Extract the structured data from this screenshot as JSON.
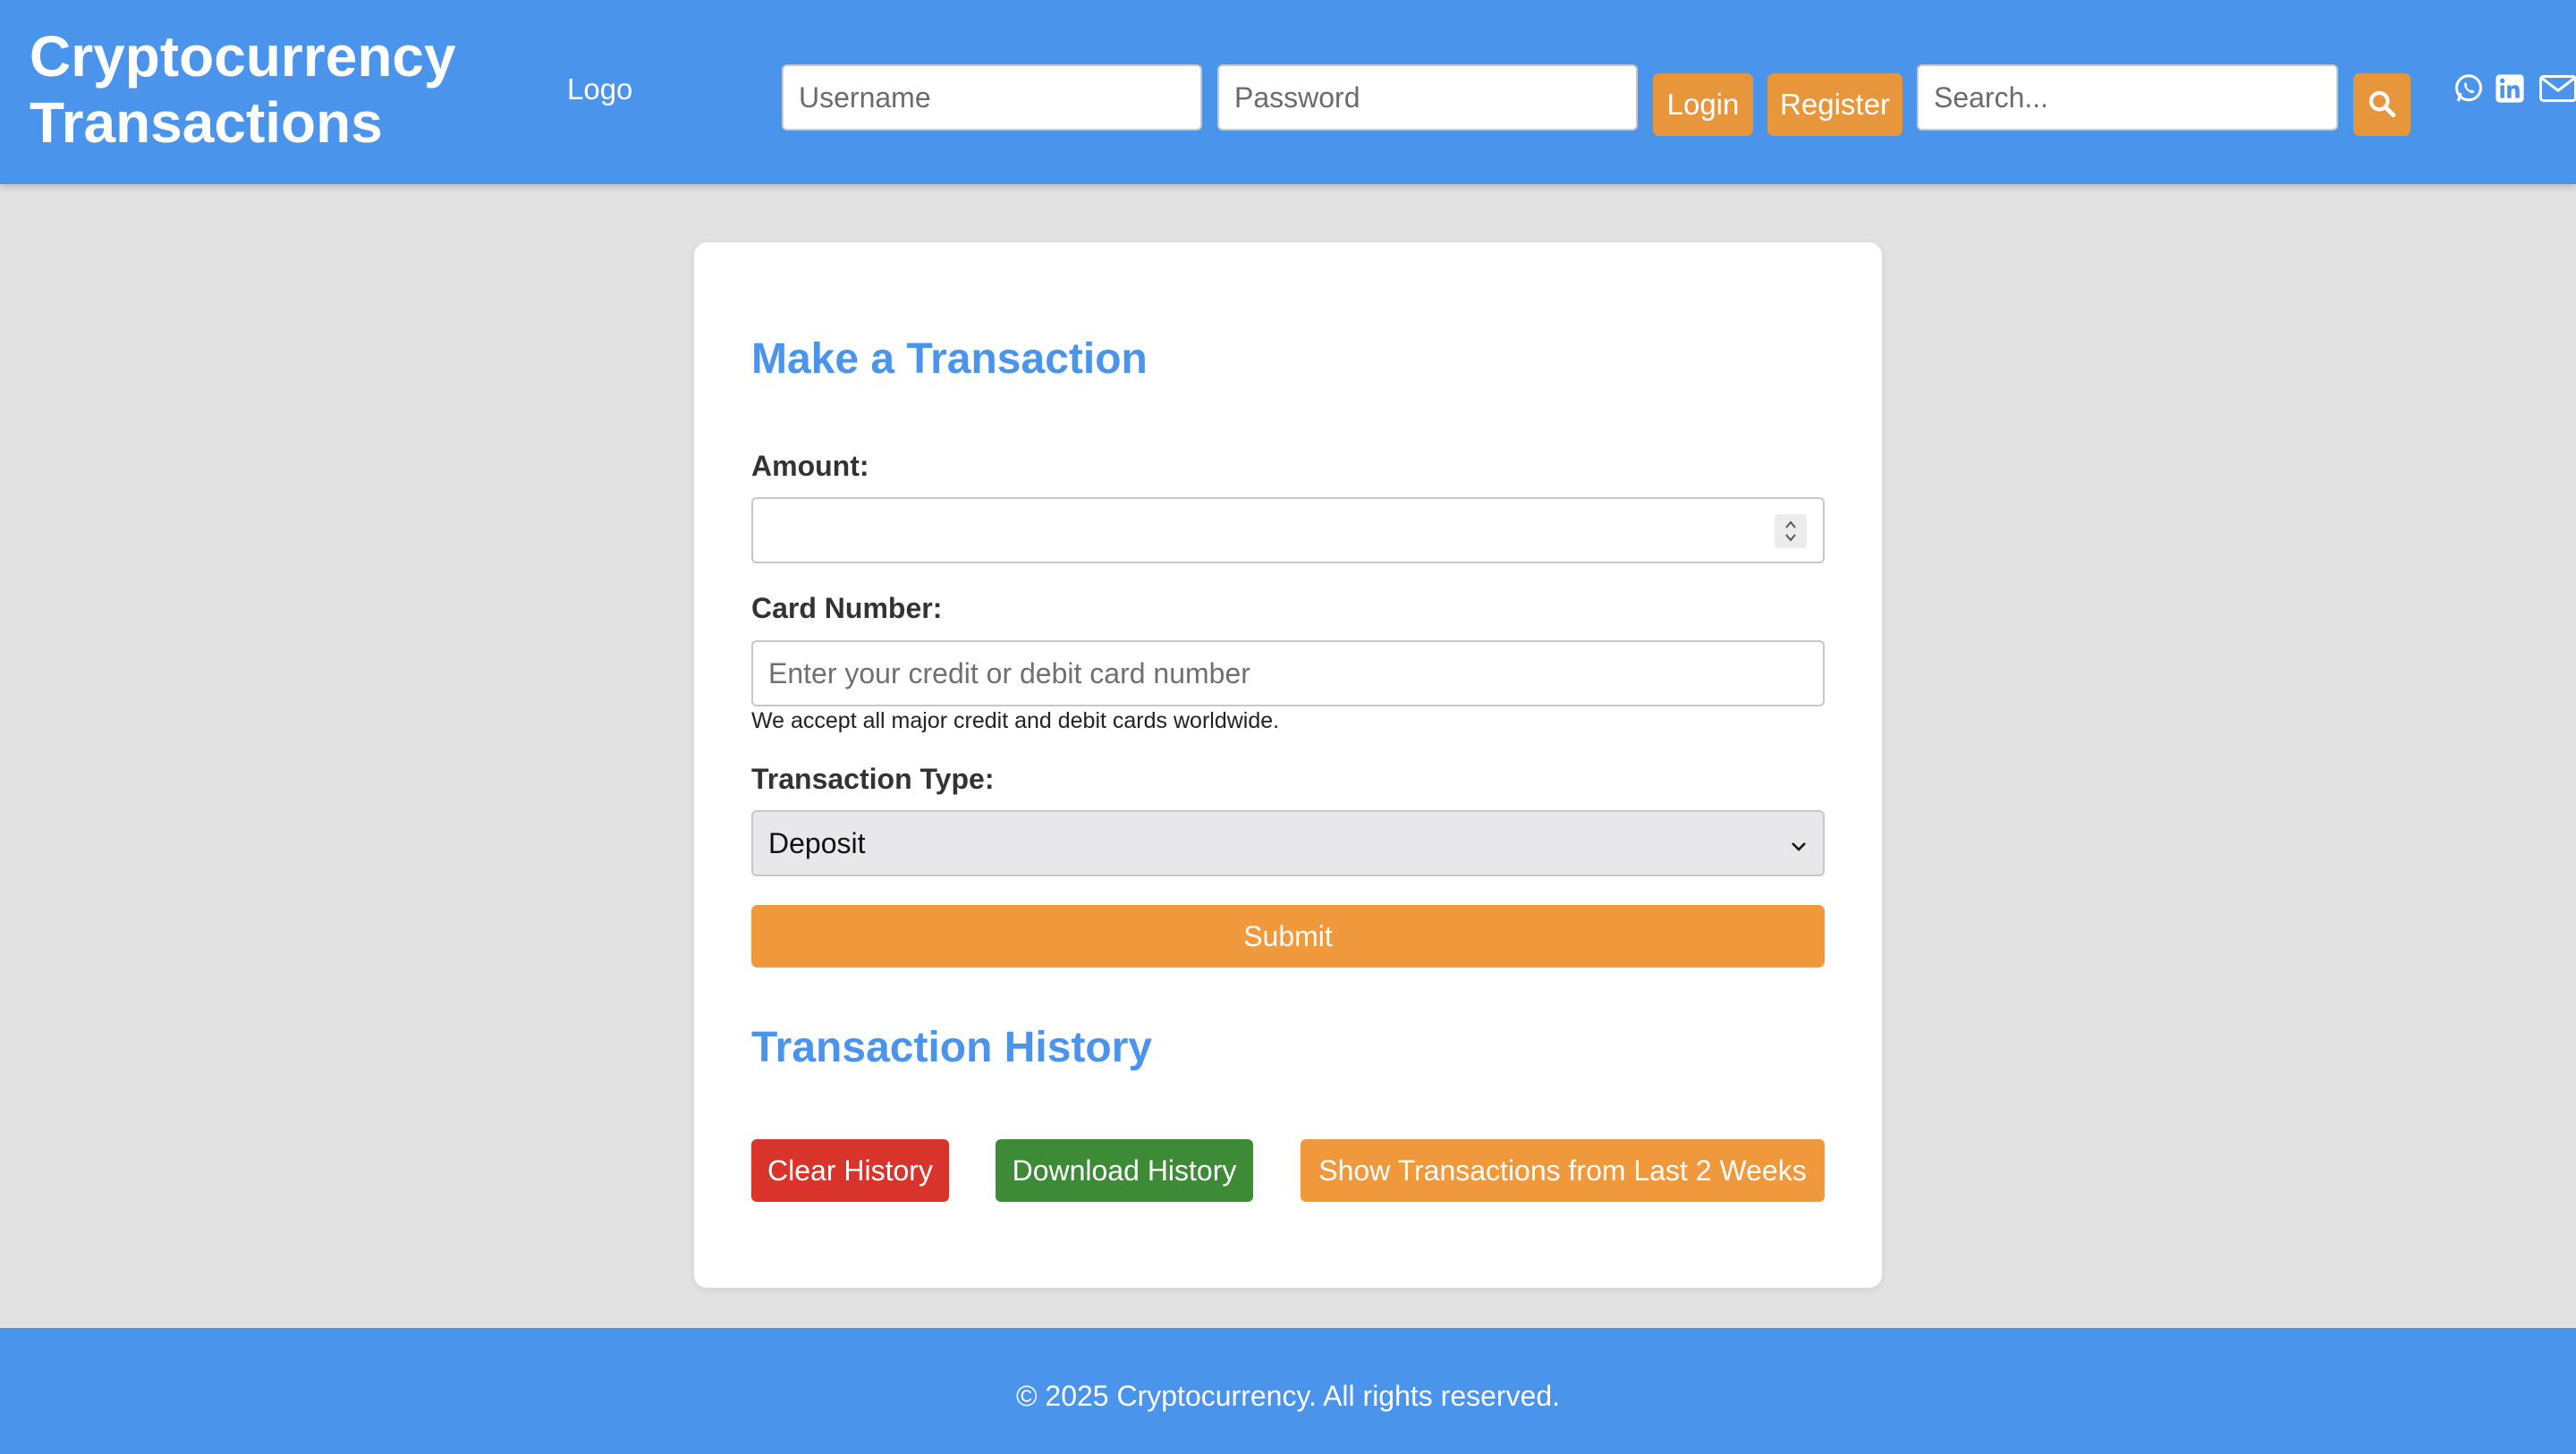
{
  "header": {
    "title": "Cryptocurrency Transactions",
    "logo_text": "Logo",
    "username_placeholder": "Username",
    "password_placeholder": "Password",
    "login_label": "Login",
    "register_label": "Register",
    "search_placeholder": "Search...",
    "icons": [
      "search-icon",
      "whatsapp-icon",
      "linkedin-icon",
      "envelope-icon"
    ]
  },
  "form": {
    "title": "Make a Transaction",
    "amount_label": "Amount:",
    "amount_value": "",
    "card_label": "Card Number:",
    "card_placeholder": "Enter your credit or debit card number",
    "card_help": "We accept all major credit and debit cards worldwide.",
    "type_label": "Transaction Type:",
    "type_selected": "Deposit",
    "submit_label": "Submit"
  },
  "history": {
    "title": "Transaction History",
    "clear_label": "Clear History",
    "download_label": "Download History",
    "recent_label": "Show Transactions from Last 2 Weeks"
  },
  "footer": {
    "text": "© 2025 Cryptocurrency. All rights reserved."
  },
  "colors": {
    "primary": "#4a94ec",
    "accent": "#ef983c",
    "danger": "#d9342b",
    "success": "#3d8b37",
    "background": "#e2e2e2"
  }
}
